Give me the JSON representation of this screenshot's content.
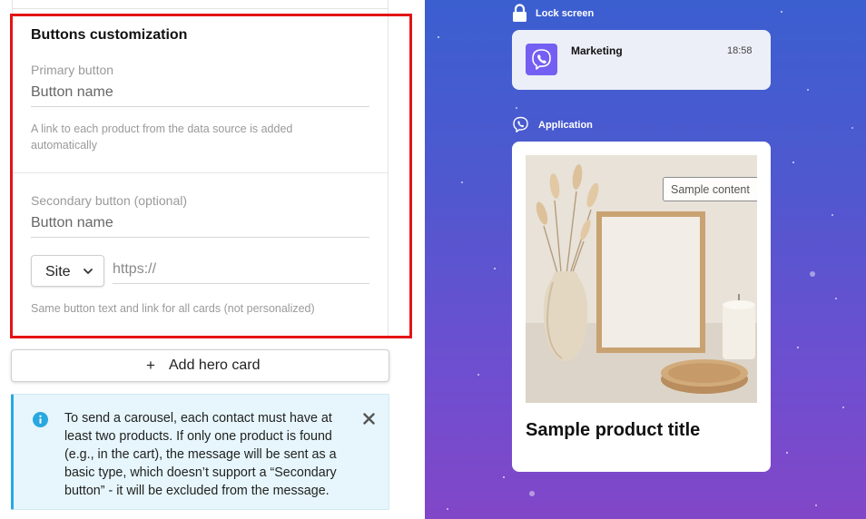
{
  "buttons_section": {
    "title": "Buttons customization",
    "primary": {
      "label": "Primary button",
      "placeholder": "Button name",
      "hint": "A link to each product from the data source is added automatically"
    },
    "secondary": {
      "label": "Secondary button (optional)",
      "placeholder": "Button name",
      "link_type": "Site",
      "url_placeholder": "https://",
      "hint": "Same button text and link for all cards (not personalized)"
    }
  },
  "add_hero_card": {
    "icon": "plus-icon",
    "label": "Add hero card"
  },
  "info_alert": {
    "icon": "info-icon",
    "message": "To send a carousel, each contact must have at least two products. If only one product is found (e.g., in the cart), the message will be sent as a basic type, which doesn’t support a “Secondary button” - it will be excluded from the message.",
    "close_icon": "close-icon"
  },
  "preview": {
    "lock_screen": {
      "label": "Lock screen",
      "icon": "lock-icon",
      "notification": {
        "app_icon": "viber-icon",
        "title": "Marketing",
        "time": "18:58"
      }
    },
    "application": {
      "label": "Application",
      "icon": "viber-icon",
      "card": {
        "image": "product-photo",
        "sample_tag": "Sample content",
        "title": "Sample product title"
      }
    }
  },
  "colors": {
    "highlight": "#e31414",
    "info_bg": "#e6f6fc",
    "info_accent": "#29a8e0",
    "viber": "#7360f2",
    "gradient_top": "#3b5fd0",
    "gradient_bottom": "#8246c8"
  }
}
